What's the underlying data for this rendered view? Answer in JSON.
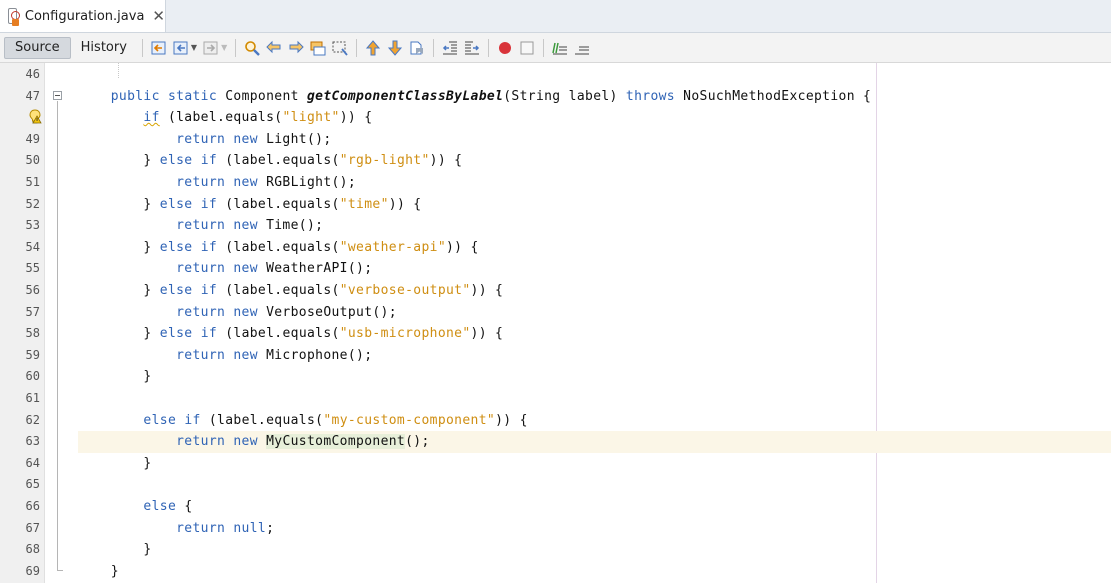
{
  "tab": {
    "title": "Configuration.java",
    "close": "✕"
  },
  "toolbar": {
    "source_label": "Source",
    "history_label": "History"
  },
  "editor": {
    "lines": [
      {
        "num": "46"
      },
      {
        "num": "47"
      },
      {
        "num": "48"
      },
      {
        "num": "49"
      },
      {
        "num": "50"
      },
      {
        "num": "51"
      },
      {
        "num": "52"
      },
      {
        "num": "53"
      },
      {
        "num": "54"
      },
      {
        "num": "55"
      },
      {
        "num": "56"
      },
      {
        "num": "57"
      },
      {
        "num": "58"
      },
      {
        "num": "59"
      },
      {
        "num": "60"
      },
      {
        "num": "61"
      },
      {
        "num": "62"
      },
      {
        "num": "63"
      },
      {
        "num": "64"
      },
      {
        "num": "65"
      },
      {
        "num": "66"
      },
      {
        "num": "67"
      },
      {
        "num": "68"
      },
      {
        "num": "69"
      }
    ],
    "code": {
      "l47": {
        "indent": "    ",
        "kw1": "public",
        "kw2": "static",
        "type": "Component",
        "method": "getComponentClassByLabel",
        "params": "(String label)",
        "kw3": "throws",
        "exc": "NoSuchMethodException {"
      },
      "l48": {
        "indent": "        ",
        "kw": "if",
        "rest1": " (label.equals(",
        "str": "\"light\"",
        "rest2": ")) {"
      },
      "l49": {
        "indent": "            ",
        "kw1": "return",
        "kw2": "new",
        "rest": " Light();"
      },
      "l50": {
        "indent": "        ",
        "pre": "} ",
        "kw1": "else",
        "kw2": "if",
        "rest1": " (label.equals(",
        "str": "\"rgb-light\"",
        "rest2": ")) {"
      },
      "l51": {
        "indent": "            ",
        "kw1": "return",
        "kw2": "new",
        "rest": " RGBLight();"
      },
      "l52": {
        "indent": "        ",
        "pre": "} ",
        "kw1": "else",
        "kw2": "if",
        "rest1": " (label.equals(",
        "str": "\"time\"",
        "rest2": ")) {"
      },
      "l53": {
        "indent": "            ",
        "kw1": "return",
        "kw2": "new",
        "rest": " Time();"
      },
      "l54": {
        "indent": "        ",
        "pre": "} ",
        "kw1": "else",
        "kw2": "if",
        "rest1": " (label.equals(",
        "str": "\"weather-api\"",
        "rest2": ")) {"
      },
      "l55": {
        "indent": "            ",
        "kw1": "return",
        "kw2": "new",
        "rest": " WeatherAPI();"
      },
      "l56": {
        "indent": "        ",
        "pre": "} ",
        "kw1": "else",
        "kw2": "if",
        "rest1": " (label.equals(",
        "str": "\"verbose-output\"",
        "rest2": ")) {"
      },
      "l57": {
        "indent": "            ",
        "kw1": "return",
        "kw2": "new",
        "rest": " VerboseOutput();"
      },
      "l58": {
        "indent": "        ",
        "pre": "} ",
        "kw1": "else",
        "kw2": "if",
        "rest1": " (label.equals(",
        "str": "\"usb-microphone\"",
        "rest2": ")) {"
      },
      "l59": {
        "indent": "            ",
        "kw1": "return",
        "kw2": "new",
        "rest": " Microphone();"
      },
      "l60": {
        "text": "        }"
      },
      "l62": {
        "indent": "        ",
        "kw1": "else",
        "kw2": "if",
        "rest1": " (label.equals(",
        "str": "\"my-custom-component\"",
        "rest2": ")) {"
      },
      "l63": {
        "indent": "            ",
        "kw1": "return",
        "kw2": "new",
        "hl": "MyCustomComponent",
        "rest": "();"
      },
      "l64": {
        "text": "        }"
      },
      "l66": {
        "indent": "        ",
        "kw": "else",
        "rest": " {"
      },
      "l67": {
        "indent": "            ",
        "kw1": "return",
        "kw2": "null",
        "rest": ";"
      },
      "l68": {
        "text": "        }"
      },
      "l69": {
        "text": "    }"
      }
    }
  },
  "colors": {
    "keyword": "#2f63b5",
    "string": "#cf8e12",
    "current_line": "#fbf6e7"
  },
  "icons": [
    "file-java-icon",
    "close-icon",
    "last-edit-icon",
    "back-icon",
    "forward-icon",
    "find-icon",
    "find-previous-icon",
    "find-next-icon",
    "toggle-highlight-icon",
    "find-selection-icon",
    "previous-bookmark-icon",
    "next-bookmark-icon",
    "toggle-bookmark-icon",
    "shift-left-icon",
    "shift-right-icon",
    "start-macro-icon",
    "stop-macro-icon",
    "comment-icon",
    "uncomment-icon",
    "warning-bulb-icon",
    "fold-icon"
  ]
}
